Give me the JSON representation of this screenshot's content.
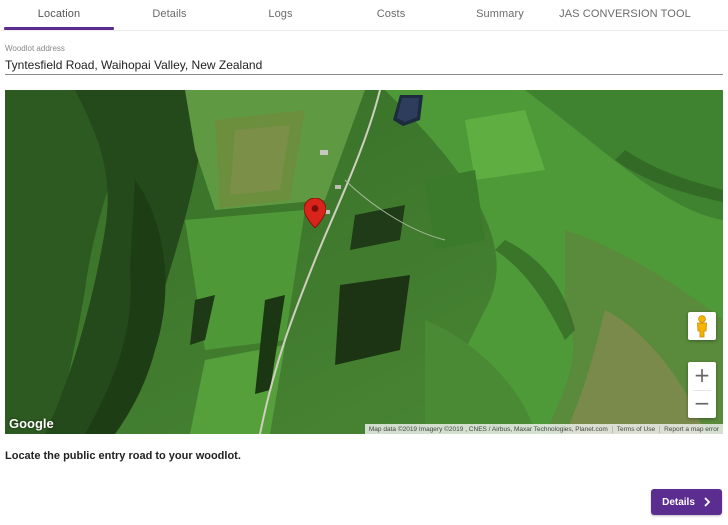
{
  "tabs": [
    {
      "label": "Location",
      "active": true
    },
    {
      "label": "Details",
      "active": false
    },
    {
      "label": "Logs",
      "active": false
    },
    {
      "label": "Costs",
      "active": false
    },
    {
      "label": "Summary",
      "active": false
    },
    {
      "label": "JAS CONVERSION TOOL",
      "active": false
    }
  ],
  "address": {
    "label": "Woodlot address",
    "value": "Tyntesfield Road, Waihopai Valley, New Zealand"
  },
  "map": {
    "logo": "Google",
    "attribution": {
      "data": "Map data ©2019 Imagery ©2019 , CNES / Airbus, Maxar Technologies, Planet.com",
      "terms": "Terms of Use",
      "report": "Report a map error"
    },
    "controls": {
      "zoom_in": "+",
      "zoom_out": "−",
      "street_view": "pegman-icon"
    },
    "marker": "map-pin-icon"
  },
  "instruction": "Locate the public entry road to your woodlot.",
  "next_button": {
    "label": "Details",
    "icon": "chevron-right-icon"
  },
  "colors": {
    "accent": "#5c2d91",
    "marker": "#d9241c"
  }
}
